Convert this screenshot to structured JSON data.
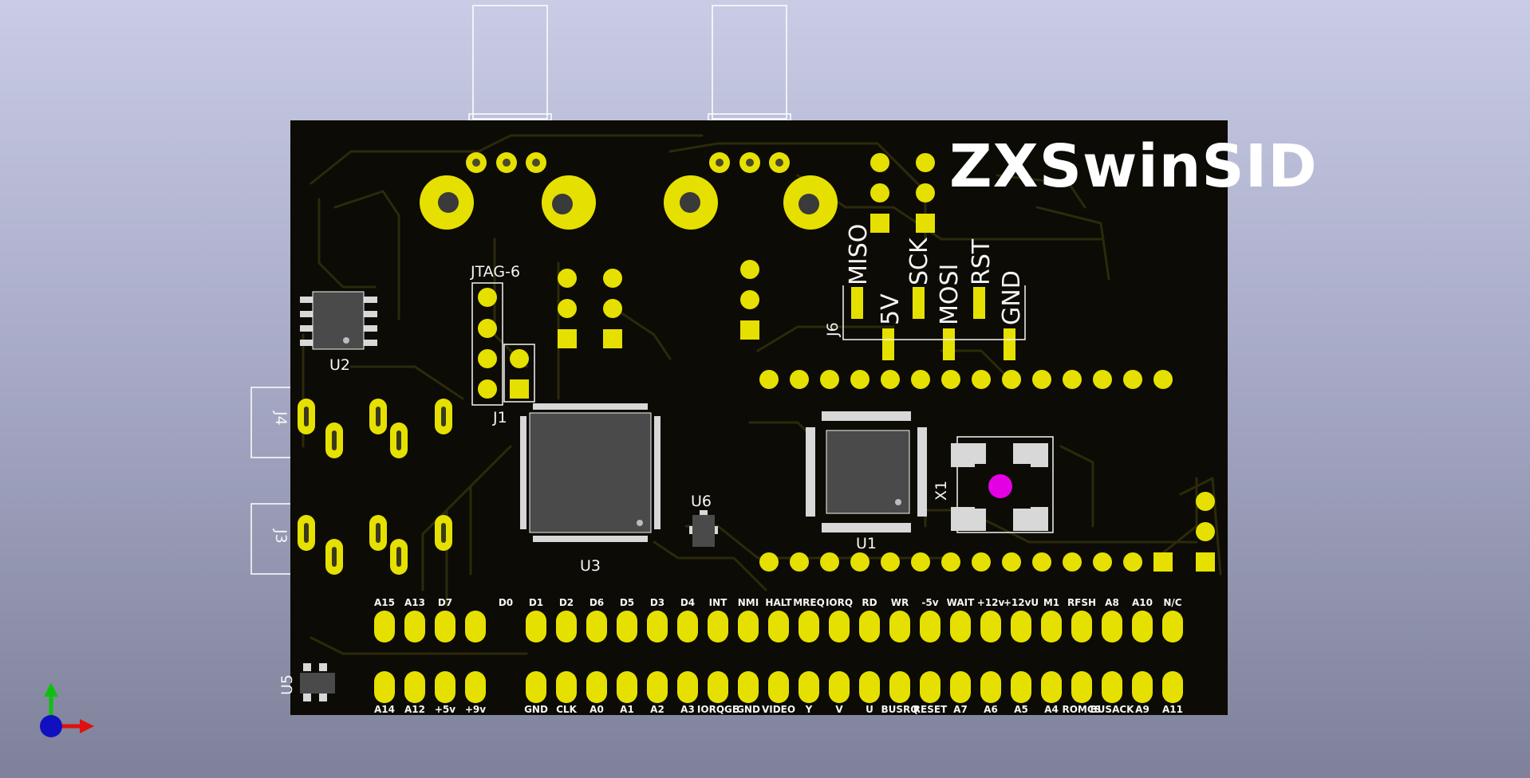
{
  "board": {
    "title": "ZXSwinSID",
    "colors": {
      "background_top": "#c9cce4",
      "background_bottom": "#7e8199",
      "board": "#0c0b05",
      "copper_trace": "#2c2a0a",
      "pad_gold": "#e6e000",
      "silkscreen": "#f5f5f5",
      "ic_body": "#4a4a4a",
      "crystal_marker": "#e400e4"
    }
  },
  "references": {
    "jtag": "JTAG-6",
    "j1": "J1",
    "u2": "U2",
    "u3": "U3",
    "u1": "U1",
    "u6": "U6",
    "u5": "U5",
    "x1": "X1",
    "j6": "J6",
    "j4": "J4",
    "j3": "J3"
  },
  "isp_labels": {
    "miso": "MISO",
    "sck": "SCK",
    "rst": "RST",
    "fivev": "5V",
    "mosi": "MOSI",
    "gnd": "GND"
  },
  "edge_connector": {
    "top_row": [
      "A15",
      "A13",
      "D7",
      "",
      "D0",
      "D1",
      "D2",
      "D6",
      "D5",
      "D3",
      "D4",
      "INT",
      "NMI",
      "HALT",
      "MREQ",
      "IORQ",
      "RD",
      "WR",
      "-5v",
      "WAIT",
      "+12v",
      "+12vU",
      "M1",
      "RFSH",
      "A8",
      "A10",
      "N/C"
    ],
    "bottom_row": [
      "A14",
      "A12",
      "+5v",
      "+9v",
      "",
      "GND",
      "CLK",
      "A0",
      "A1",
      "A2",
      "A3",
      "IORQGE",
      "GND",
      "VIDEO",
      "Y",
      "V",
      "U",
      "BUSRQ",
      "RESET",
      "A7",
      "A6",
      "A5",
      "A4",
      "ROMCS",
      "BUSACK",
      "A9",
      "A11"
    ]
  },
  "axes_gizmo": {
    "x_color": "#e01010",
    "y_color": "#10c010",
    "z_color": "#1010c0"
  }
}
